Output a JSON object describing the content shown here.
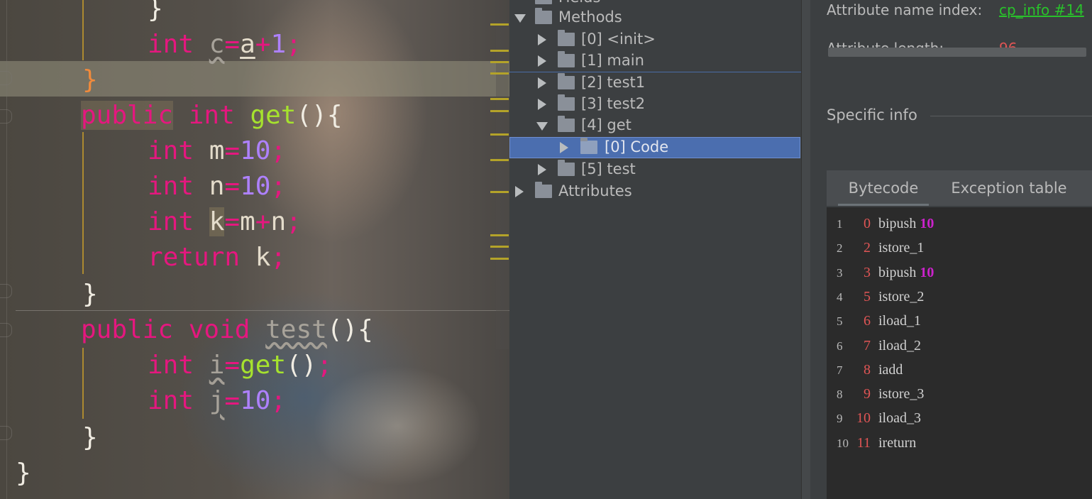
{
  "colors": {
    "keyword": "#e5177f",
    "function": "#a6e22e",
    "number": "#ae81ff",
    "link": "#29c22b",
    "offset": "#e05555",
    "operand": "#cc22cc",
    "selection": "#4b6eaf"
  },
  "editor": {
    "lines": [
      {
        "tokens": [
          [
            "punct",
            "}"
          ]
        ]
      },
      {
        "tokens": [
          [
            "kw",
            "int"
          ],
          [
            "pl",
            " "
          ],
          [
            "dim wavy",
            "c"
          ],
          [
            "kw",
            "="
          ],
          [
            "id ul",
            "a"
          ],
          [
            "kw",
            "+"
          ],
          [
            "num",
            "1"
          ],
          [
            "semi",
            ";"
          ]
        ]
      },
      {
        "tokens": [
          [
            "brace-o",
            "}"
          ]
        ]
      },
      {
        "tokens": [
          [
            "kw kwbg",
            "public"
          ],
          [
            "pl",
            " "
          ],
          [
            "kw",
            "int"
          ],
          [
            "pl",
            " "
          ],
          [
            "fn",
            "get"
          ],
          [
            "punct",
            "(){"
          ]
        ]
      },
      {
        "tokens": [
          [
            "kw",
            "int"
          ],
          [
            "pl",
            " "
          ],
          [
            "id",
            "m"
          ],
          [
            "kw",
            "="
          ],
          [
            "num",
            "10"
          ],
          [
            "semi",
            ";"
          ]
        ]
      },
      {
        "tokens": [
          [
            "kw",
            "int"
          ],
          [
            "pl",
            " "
          ],
          [
            "id",
            "n"
          ],
          [
            "kw",
            "="
          ],
          [
            "num",
            "10"
          ],
          [
            "semi",
            ";"
          ]
        ]
      },
      {
        "tokens": [
          [
            "kw",
            "int"
          ],
          [
            "pl",
            " "
          ],
          [
            "id boxed",
            "k"
          ],
          [
            "kw",
            "="
          ],
          [
            "id",
            "m"
          ],
          [
            "kw",
            "+"
          ],
          [
            "id",
            "n"
          ],
          [
            "semi",
            ";"
          ]
        ]
      },
      {
        "tokens": [
          [
            "kw",
            "return"
          ],
          [
            "pl",
            " "
          ],
          [
            "id",
            "k"
          ],
          [
            "semi",
            ";"
          ]
        ]
      },
      {
        "tokens": [
          [
            "punct",
            "}"
          ]
        ]
      },
      {
        "tokens": [
          [
            "kw",
            "public"
          ],
          [
            "pl",
            " "
          ],
          [
            "kw",
            "void"
          ],
          [
            "pl",
            " "
          ],
          [
            "dim wavy",
            "test"
          ],
          [
            "punct",
            "(){"
          ]
        ]
      },
      {
        "tokens": [
          [
            "kw",
            "int"
          ],
          [
            "pl",
            " "
          ],
          [
            "dim wavy",
            "i"
          ],
          [
            "kw",
            "="
          ],
          [
            "fn",
            "get"
          ],
          [
            "punct",
            "()"
          ],
          [
            "semi",
            ";"
          ]
        ]
      },
      {
        "tokens": [
          [
            "kw",
            "int"
          ],
          [
            "pl",
            " "
          ],
          [
            "dim wavy",
            "j"
          ],
          [
            "kw",
            "="
          ],
          [
            "num",
            "10"
          ],
          [
            "semi",
            ";"
          ]
        ]
      },
      {
        "tokens": [
          [
            "punct",
            "}"
          ]
        ]
      },
      {
        "tokens": [
          [
            "punct",
            "}"
          ]
        ]
      }
    ]
  },
  "tree": {
    "clipped_top_label": "Fields",
    "methods_label": "Methods",
    "items": [
      {
        "label": "[0] <init>"
      },
      {
        "label": "[1] main"
      },
      {
        "label": "[2] test1"
      },
      {
        "label": "[3] test2"
      },
      {
        "label": "[4] get"
      },
      {
        "label": "[0] Code"
      },
      {
        "label": "[5] test"
      }
    ],
    "attributes_label": "Attributes"
  },
  "info": {
    "name_index_label": "Attribute name index:",
    "name_index_value": "cp_info #14",
    "length_label": "Attribute length:",
    "length_value": "96",
    "specific_info_label": "Specific info",
    "tabs": {
      "bytecode": "Bytecode",
      "exception": "Exception table"
    },
    "bytecode": [
      {
        "line": "1",
        "offset": "0",
        "op": "bipush",
        "arg": "10"
      },
      {
        "line": "2",
        "offset": "2",
        "op": "istore_1",
        "arg": ""
      },
      {
        "line": "3",
        "offset": "3",
        "op": "bipush",
        "arg": "10"
      },
      {
        "line": "4",
        "offset": "5",
        "op": "istore_2",
        "arg": ""
      },
      {
        "line": "5",
        "offset": "6",
        "op": "iload_1",
        "arg": ""
      },
      {
        "line": "6",
        "offset": "7",
        "op": "iload_2",
        "arg": ""
      },
      {
        "line": "7",
        "offset": "8",
        "op": "iadd",
        "arg": ""
      },
      {
        "line": "8",
        "offset": "9",
        "op": "istore_3",
        "arg": ""
      },
      {
        "line": "9",
        "offset": "10",
        "op": "iload_3",
        "arg": ""
      },
      {
        "line": "10",
        "offset": "11",
        "op": "ireturn",
        "arg": ""
      }
    ]
  }
}
